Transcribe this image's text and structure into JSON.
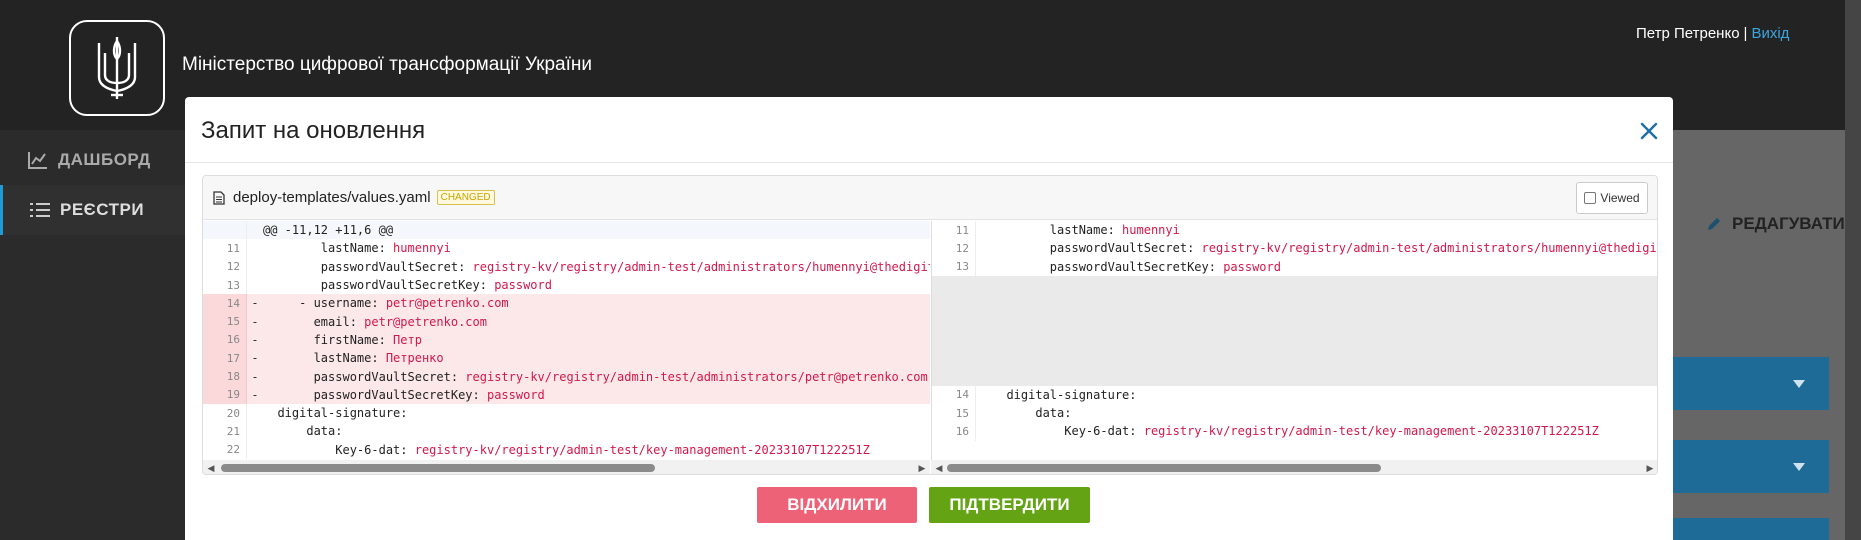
{
  "header": {
    "org_title": "Міністерство цифрової трансформації України",
    "user_name": "Петр Петренко",
    "separator": "|",
    "logout": "Вихід"
  },
  "sidebar": {
    "items": [
      {
        "label": "ДАШБОРД",
        "icon": "chart-icon",
        "active": false
      },
      {
        "label": "РЕЄСТРИ",
        "icon": "list-icon",
        "active": true
      }
    ]
  },
  "main": {
    "edit_label": "РЕДАГУВАТИ"
  },
  "modal": {
    "title": "Запит на оновлення",
    "file": {
      "name": "deploy-templates/values.yaml",
      "badge": "CHANGED",
      "viewed_label": "Viewed"
    },
    "left_rows": [
      {
        "type": "hunk",
        "ln": "",
        "mark": "",
        "text": "@@ -11,12 +11,6 @@",
        "val": ""
      },
      {
        "type": "ctx",
        "ln": "11",
        "mark": "",
        "text": "        lastName: ",
        "val": "humennyi"
      },
      {
        "type": "ctx",
        "ln": "12",
        "mark": "",
        "text": "        passwordVaultSecret: ",
        "val": "registry-kv/registry/admin-test/administrators/humennyi@thedigit"
      },
      {
        "type": "ctx",
        "ln": "13",
        "mark": "",
        "text": "        passwordVaultSecretKey: ",
        "val": "password"
      },
      {
        "type": "del",
        "ln": "14",
        "mark": "-",
        "text": "     - username: ",
        "val": "petr@petrenko.com"
      },
      {
        "type": "del",
        "ln": "15",
        "mark": "-",
        "text": "       email: ",
        "val": "petr@petrenko.com"
      },
      {
        "type": "del",
        "ln": "16",
        "mark": "-",
        "text": "       firstName: ",
        "val": "Петр"
      },
      {
        "type": "del",
        "ln": "17",
        "mark": "-",
        "text": "       lastName: ",
        "val": "Петренко"
      },
      {
        "type": "del",
        "ln": "18",
        "mark": "-",
        "text": "       passwordVaultSecret: ",
        "val": "registry-kv/registry/admin-test/administrators/petr@petrenko.com"
      },
      {
        "type": "del",
        "ln": "19",
        "mark": "-",
        "text": "       passwordVaultSecretKey: ",
        "val": "password"
      },
      {
        "type": "ctx",
        "ln": "20",
        "mark": "",
        "text": "  digital-signature:",
        "val": ""
      },
      {
        "type": "ctx",
        "ln": "21",
        "mark": "",
        "text": "      data:",
        "val": ""
      },
      {
        "type": "ctx",
        "ln": "22",
        "mark": "",
        "text": "          Key-6-dat: ",
        "val": "registry-kv/registry/admin-test/key-management-20233107T122251Z"
      }
    ],
    "right_rows": [
      {
        "type": "ctx",
        "ln": "11",
        "mark": "",
        "text": "        lastName: ",
        "val": "humennyi"
      },
      {
        "type": "ctx",
        "ln": "12",
        "mark": "",
        "text": "        passwordVaultSecret: ",
        "val": "registry-kv/registry/admin-test/administrators/humennyi@thedigita"
      },
      {
        "type": "ctx",
        "ln": "13",
        "mark": "",
        "text": "        passwordVaultSecretKey: ",
        "val": "password"
      },
      {
        "type": "empty",
        "ln": "",
        "mark": "",
        "text": "",
        "val": ""
      },
      {
        "type": "empty",
        "ln": "",
        "mark": "",
        "text": "",
        "val": ""
      },
      {
        "type": "empty",
        "ln": "",
        "mark": "",
        "text": "",
        "val": ""
      },
      {
        "type": "empty",
        "ln": "",
        "mark": "",
        "text": "",
        "val": ""
      },
      {
        "type": "empty",
        "ln": "",
        "mark": "",
        "text": "",
        "val": ""
      },
      {
        "type": "empty",
        "ln": "",
        "mark": "",
        "text": "",
        "val": ""
      },
      {
        "type": "ctx",
        "ln": "14",
        "mark": "",
        "text": "  digital-signature:",
        "val": ""
      },
      {
        "type": "ctx",
        "ln": "15",
        "mark": "",
        "text": "      data:",
        "val": ""
      },
      {
        "type": "ctx",
        "ln": "16",
        "mark": "",
        "text": "          Key-6-dat: ",
        "val": "registry-kv/registry/admin-test/key-management-20233107T122251Z"
      }
    ],
    "reject_label": "ВІДХИЛИТИ",
    "confirm_label": "ПІДТВЕРДИТИ"
  },
  "colors": {
    "accent": "#1f9bd6",
    "reject": "#ee6277",
    "confirm": "#64a314",
    "deleted_bg": "#fde8e9",
    "value_text": "#d3184b"
  }
}
